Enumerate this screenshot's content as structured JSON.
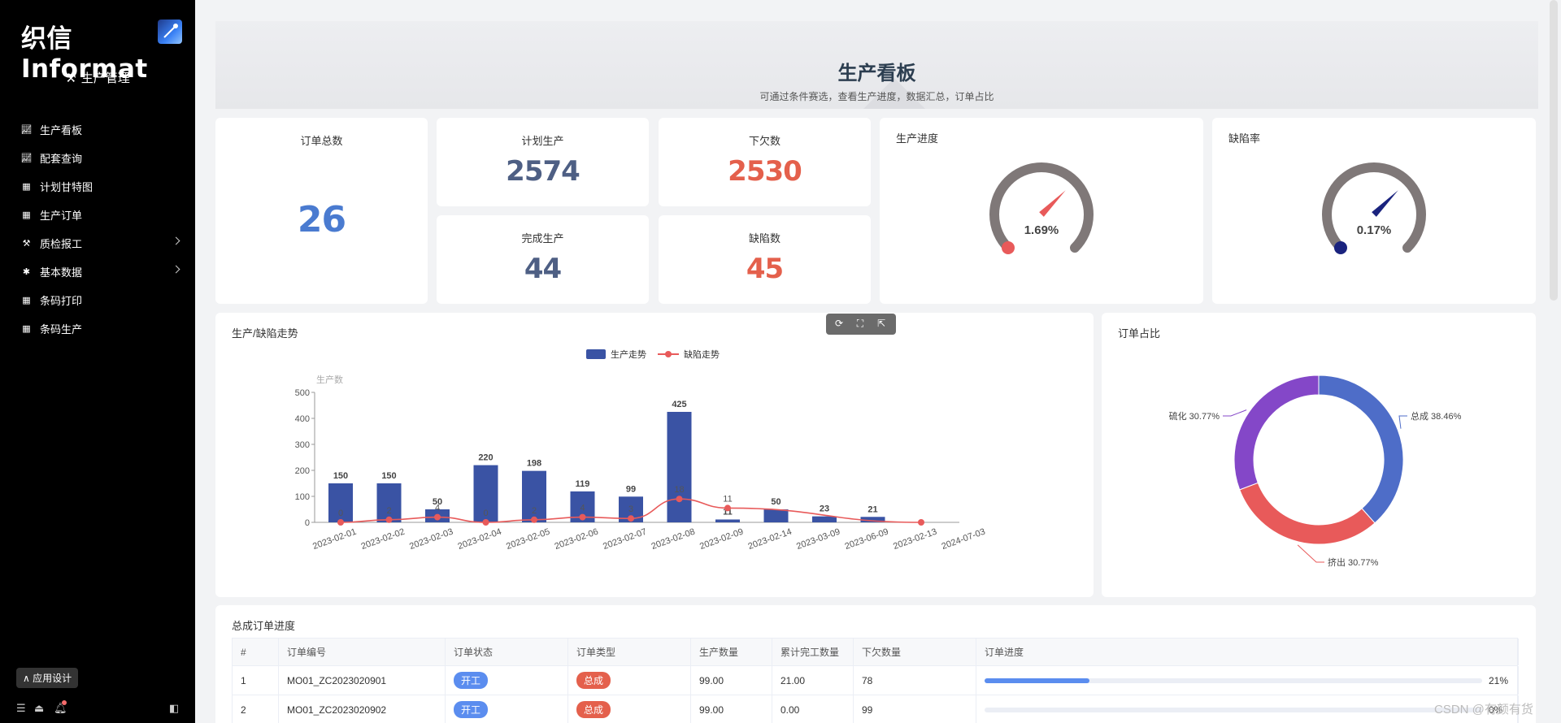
{
  "sidebar": {
    "logo": "织信 Informat",
    "app_title": "生产管理",
    "items": [
      {
        "label": "生产看板",
        "icon": "line-chart-icon",
        "expandable": false
      },
      {
        "label": "配套查询",
        "icon": "line-chart-icon",
        "expandable": false
      },
      {
        "label": "计划甘特图",
        "icon": "table-icon",
        "expandable": false
      },
      {
        "label": "生产订单",
        "icon": "table-icon",
        "expandable": false
      },
      {
        "label": "质检报工",
        "icon": "hammer-icon",
        "expandable": true
      },
      {
        "label": "基本数据",
        "icon": "asterisk-icon",
        "expandable": true
      },
      {
        "label": "条码打印",
        "icon": "table-icon",
        "expandable": false
      },
      {
        "label": "条码生产",
        "icon": "table-icon",
        "expandable": false
      }
    ],
    "app_design": "应用设计"
  },
  "header": {
    "title": "生产看板",
    "subtitle": "可通过条件赛选，查看生产进度，数据汇总，订单占比"
  },
  "kpis": {
    "order_total": {
      "label": "订单总数",
      "value": "26"
    },
    "planned": {
      "label": "计划生产",
      "value": "2574"
    },
    "owed": {
      "label": "下欠数",
      "value": "2530"
    },
    "completed": {
      "label": "完成生产",
      "value": "44"
    },
    "defects": {
      "label": "缺陷数",
      "value": "45"
    }
  },
  "gauges": {
    "progress": {
      "label": "生产进度",
      "text": "1.69%",
      "value": 1.69,
      "color": "#e85a5a"
    },
    "defect_rate": {
      "label": "缺陷率",
      "text": "0.17%",
      "value": 0.17,
      "color": "#1a237e"
    }
  },
  "trend_card": {
    "title": "生产/缺陷走势"
  },
  "pie_card": {
    "title": "订单占比"
  },
  "chart_data": [
    {
      "type": "bar",
      "title": "生产/缺陷走势",
      "ylabel": "生产数",
      "ylim": [
        0,
        500
      ],
      "yticks": [
        0,
        100,
        200,
        300,
        400,
        500
      ],
      "legend": [
        "生产走势",
        "缺陷走势"
      ],
      "categories": [
        "2023-02-01",
        "2023-02-02",
        "2023-02-03",
        "2023-02-04",
        "2023-02-05",
        "2023-02-06",
        "2023-02-07",
        "2023-02-08",
        "2023-02-09",
        "2023-02-14",
        "2023-03-09",
        "2023-06-09",
        "2023-02-13",
        "2024-07-03"
      ],
      "series": [
        {
          "name": "生产走势",
          "type": "bar",
          "color": "#3a53a4",
          "values": [
            150,
            150,
            50,
            220,
            198,
            119,
            99,
            425,
            11,
            50,
            23,
            21,
            null,
            null
          ],
          "labels": [
            "150",
            "150",
            "50",
            "220",
            "198",
            "119",
            "99",
            "425",
            "11",
            "50",
            "23",
            "21",
            "",
            ""
          ]
        },
        {
          "name": "缺陷走势",
          "type": "line",
          "color": "#e85a5a",
          "values": [
            0,
            2,
            4,
            0,
            2,
            4,
            3,
            18,
            11,
            null,
            null,
            null,
            0,
            null
          ],
          "labels": [
            "0",
            "2",
            "4",
            "0",
            "2",
            "4",
            "3",
            "18",
            "11",
            "",
            "",
            "",
            "",
            ""
          ]
        }
      ]
    },
    {
      "type": "pie",
      "title": "订单占比",
      "slices": [
        {
          "name": "总成",
          "value": 38.46,
          "label": "总成 38.46%",
          "color": "#4e6dc8"
        },
        {
          "name": "挤出",
          "value": 30.77,
          "label": "挤出 30.77%",
          "color": "#e85a5a"
        },
        {
          "name": "硫化",
          "value": 30.77,
          "label": "硫化 30.77%",
          "color": "#8447c8"
        }
      ]
    }
  ],
  "table": {
    "title": "总成订单进度",
    "headers": [
      "#",
      "订单编号",
      "订单状态",
      "订单类型",
      "生产数量",
      "累计完工数量",
      "下欠数量",
      "订单进度"
    ],
    "rows": [
      {
        "index": "1",
        "order_no": "MO01_ZC2023020901",
        "status": "开工",
        "type": "总成",
        "qty": "99.00",
        "done": "21.00",
        "owed": "78",
        "progress_text": "21%",
        "progress": 21
      },
      {
        "index": "2",
        "order_no": "MO01_ZC2023020902",
        "status": "开工",
        "type": "总成",
        "qty": "99.00",
        "done": "0.00",
        "owed": "99",
        "progress_text": "0%",
        "progress": 0
      }
    ]
  },
  "watermark": "CSDN @有颜有货",
  "colors": {
    "accent": "#4a7bd0",
    "status_tag": "#5b8def",
    "type_tag": "#e4604c"
  }
}
